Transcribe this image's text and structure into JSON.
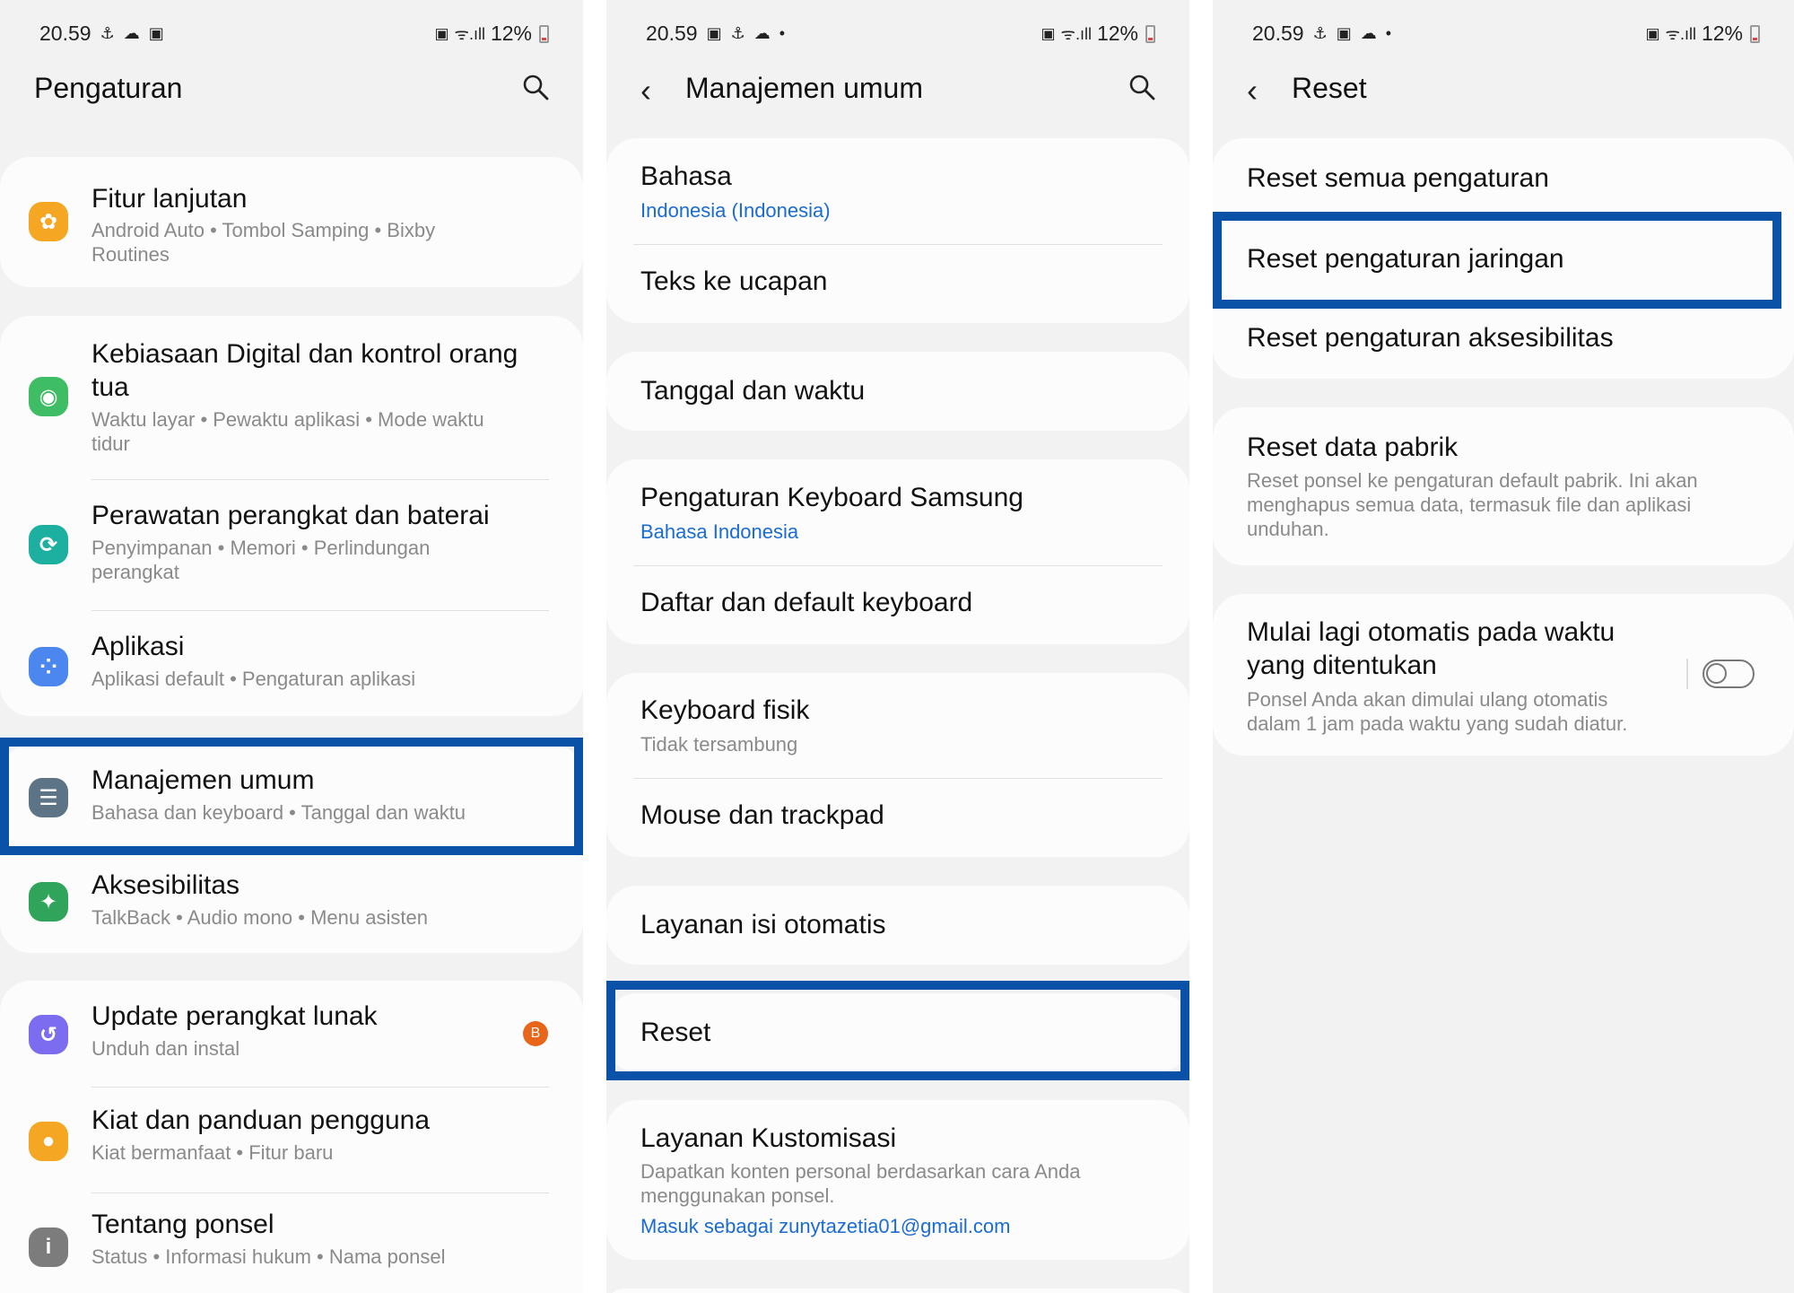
{
  "status": {
    "time": "20.59",
    "battery": "12%",
    "icons_s1": [
      "vpn-icon",
      "weather-icon",
      "gallery-icon"
    ],
    "icons_s2": [
      "gallery-icon",
      "vpn-icon",
      "weather-icon",
      "dot-icon"
    ],
    "icons_s3": [
      "vpn-icon",
      "gallery-icon",
      "weather-icon",
      "dot-icon"
    ]
  },
  "colors": {
    "highlight": "#0a52a8",
    "link": "#1a6bd2",
    "badge": "#e8661a"
  },
  "screen1": {
    "title": "Pengaturan",
    "items": [
      {
        "title": "Fitur lanjutan",
        "sub1": "Android Auto  •  Tombol Samping  •  Bixby",
        "sub2": "Routines",
        "icon": "star-icon",
        "color": "#f5a623"
      },
      {
        "title1": "Kebiasaan Digital dan kontrol orang",
        "title2": "tua",
        "sub1": "Waktu layar  •  Pewaktu aplikasi  •  Mode waktu",
        "sub2": "tidur",
        "icon": "digital-wellbeing-icon",
        "color": "#3fbd64"
      },
      {
        "title": "Perawatan perangkat dan baterai",
        "sub1": "Penyimpanan  •  Memori  •  Perlindungan",
        "sub2": "perangkat",
        "icon": "device-care-icon",
        "color": "#1db0a0"
      },
      {
        "title": "Aplikasi",
        "sub1": "Aplikasi default  •  Pengaturan aplikasi",
        "icon": "apps-icon",
        "color": "#4c87f0"
      },
      {
        "title": "Manajemen umum",
        "sub1": "Bahasa dan keyboard  •  Tanggal dan waktu",
        "icon": "sliders-icon",
        "color": "#5d7386"
      },
      {
        "title": "Aksesibilitas",
        "sub1": "TalkBack  •  Audio mono  •  Menu asisten",
        "icon": "accessibility-icon",
        "color": "#2fa45a"
      },
      {
        "title": "Update perangkat lunak",
        "sub1": "Unduh dan instal",
        "icon": "update-icon",
        "color": "#7b6cf0",
        "badge": "B"
      },
      {
        "title": "Kiat dan panduan pengguna",
        "sub1": "Kiat bermanfaat  •  Fitur baru",
        "icon": "bulb-icon",
        "color": "#f5a623"
      },
      {
        "title": "Tentang ponsel",
        "sub1": "Status  •  Informasi hukum  •  Nama ponsel",
        "icon": "info-icon",
        "color": "#7c7c7c"
      }
    ]
  },
  "screen2": {
    "title": "Manajemen umum",
    "items": [
      {
        "title": "Bahasa",
        "sub": "Indonesia (Indonesia)"
      },
      {
        "title": "Teks ke ucapan"
      },
      {
        "title": "Tanggal dan waktu"
      },
      {
        "title": "Pengaturan Keyboard Samsung",
        "sub": "Bahasa Indonesia"
      },
      {
        "title": "Daftar dan default keyboard"
      },
      {
        "title": "Keyboard fisik",
        "sub": "Tidak tersambung"
      },
      {
        "title": "Mouse dan trackpad"
      },
      {
        "title": "Layanan isi otomatis"
      },
      {
        "title": "Reset"
      },
      {
        "title": "Layanan Kustomisasi",
        "sub1": "Dapatkan konten personal berdasarkan cara Anda",
        "sub2": "menggunakan ponsel.",
        "link": "Masuk sebagai zunytazetia01@gmail.com"
      }
    ]
  },
  "screen3": {
    "title": "Reset",
    "items": [
      {
        "title": "Reset semua pengaturan"
      },
      {
        "title": "Reset pengaturan jaringan"
      },
      {
        "title": "Reset pengaturan aksesibilitas"
      },
      {
        "title": "Reset data pabrik",
        "sub1": "Reset ponsel ke pengaturan default pabrik. Ini akan",
        "sub2": "menghapus semua data, termasuk file dan aplikasi",
        "sub3": "unduhan."
      },
      {
        "title1": "Mulai lagi otomatis pada waktu",
        "title2": "yang ditentukan",
        "sub1": "Ponsel Anda akan dimulai ulang otomatis",
        "sub2": "dalam 1 jam pada waktu yang sudah diatur.",
        "toggle": false
      }
    ]
  }
}
